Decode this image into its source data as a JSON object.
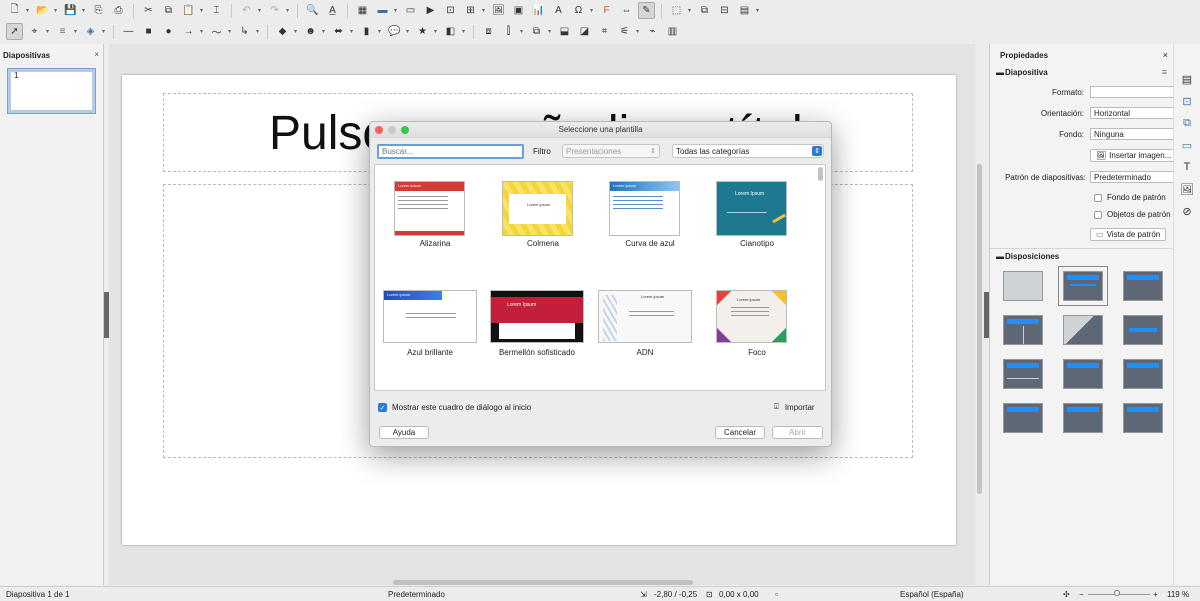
{
  "left_panel": {
    "title": "Diapositivas",
    "close": "×",
    "slide_number": "1"
  },
  "slide": {
    "title_text": "Pulse para añadir un título"
  },
  "dialog": {
    "title": "Seleccione una plantilla",
    "search_placeholder": "Buscar...",
    "filter_label": "Filtro",
    "filter_value": "Presentaciones",
    "category_value": "Todas las categorías",
    "templates": [
      {
        "name": "Alizarina",
        "thumb_text": "Lorem ipsum"
      },
      {
        "name": "Colmena",
        "thumb_text": "Lorem ipsum"
      },
      {
        "name": "Curva de azul",
        "thumb_text": "Lorem ipsum"
      },
      {
        "name": "Cianotipo",
        "thumb_text": "Lorem Ipsum"
      },
      {
        "name": "Azul brillante",
        "thumb_text": "Lorem ipsum"
      },
      {
        "name": "Bermellón sofisticado",
        "thumb_text": "Lorem Ipsum"
      },
      {
        "name": "ADN",
        "thumb_text": "Lorem ipsum"
      },
      {
        "name": "Foco",
        "thumb_text": "Lorem ipsum"
      }
    ],
    "show_checkbox_label": "Mostrar este cuadro de diálogo al inicio",
    "import_label": "Importar",
    "help_button": "Ayuda",
    "cancel_button": "Cancelar",
    "open_button": "Abrir"
  },
  "sidebar": {
    "title": "Propiedades",
    "close": "×",
    "section_slide": "Diapositiva",
    "format_label": "Formato:",
    "format_value": "",
    "orientation_label": "Orientación:",
    "orientation_value": "Horizontal",
    "background_label": "Fondo:",
    "background_value": "Ninguna",
    "insert_image_button": "Insertar imagen...",
    "master_label": "Patrón de diapositivas:",
    "master_value": "Predeterminado",
    "master_background_label": "Fondo de patrón",
    "master_objects_label": "Objetos de patrón",
    "master_view_button": "Vista de patrón",
    "section_layouts": "Disposiciones"
  },
  "statusbar": {
    "slide_info": "Diapositiva 1 de 1",
    "master": "Predeterminado",
    "position": "-2,80 / -0,25",
    "size": "0,00 x 0,00",
    "language": "Español (España)",
    "zoom": "119 %"
  }
}
